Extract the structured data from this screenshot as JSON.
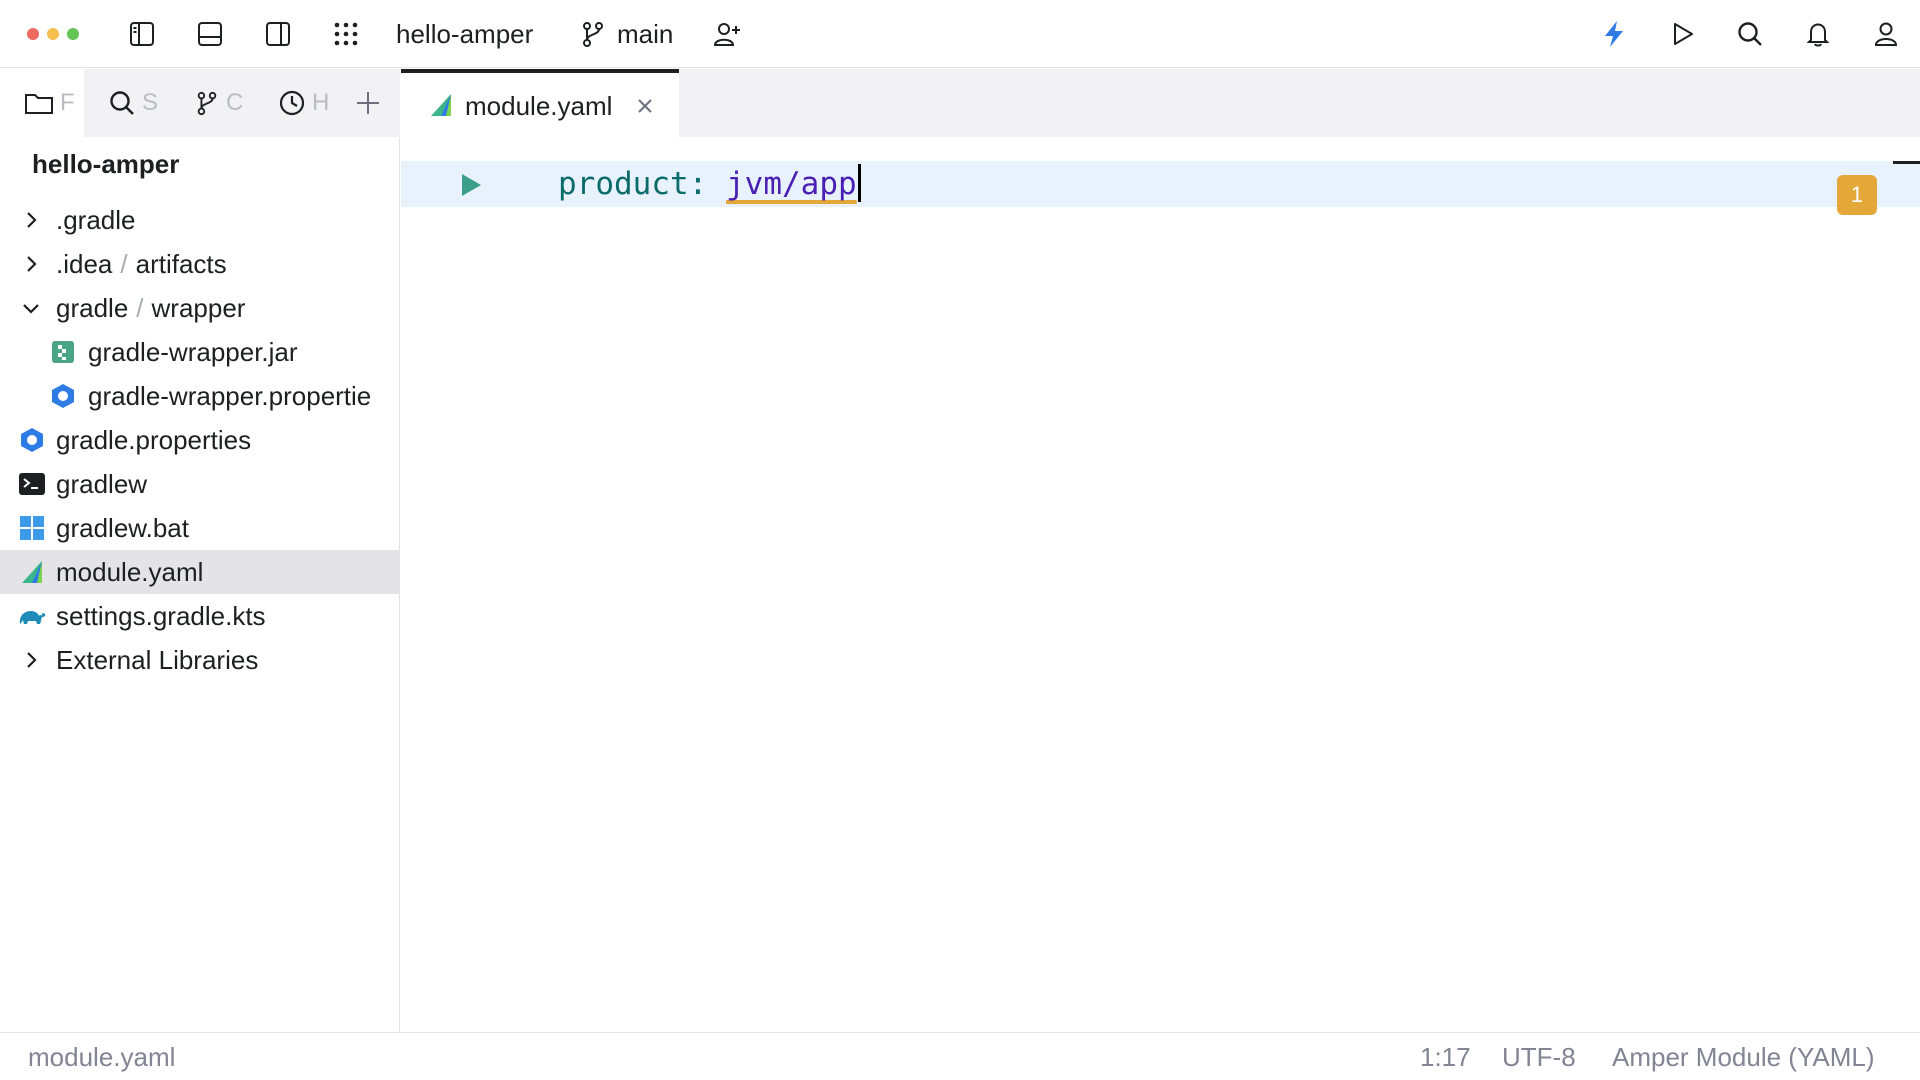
{
  "toolbar": {
    "project_name": "hello-amper",
    "branch": "main",
    "icons": [
      "left-panel-icon",
      "bottom-panel-icon",
      "right-panel-icon",
      "apps-grid-icon",
      "git-branch-icon",
      "add-user-icon",
      "lightning-icon",
      "run-icon",
      "search-icon",
      "bell-icon",
      "profile-icon"
    ],
    "colors": {
      "close": "#ed6a5e",
      "minimize": "#f5bf4f",
      "maximize": "#62c554",
      "accent": "#2f7be6"
    }
  },
  "sidebar": {
    "tabs": [
      {
        "label": "F",
        "icon": "folder-icon"
      },
      {
        "label": "S",
        "icon": "search-icon"
      },
      {
        "label": "C",
        "icon": "git-branch-icon"
      },
      {
        "label": "H",
        "icon": "clock-icon"
      }
    ],
    "project_title": "hello-amper",
    "tree": [
      {
        "label": ".gradle",
        "expand": "collapsed"
      },
      {
        "label": ".idea",
        "label2": "artifacts",
        "expand": "collapsed"
      },
      {
        "label": "gradle",
        "label2": "wrapper",
        "expand": "expanded"
      },
      {
        "label": "gradle-wrapper.jar",
        "icon": "jar-icon"
      },
      {
        "label": "gradle-wrapper.propertie",
        "icon": "properties-icon"
      },
      {
        "label": "gradle.properties",
        "icon": "properties-icon"
      },
      {
        "label": "gradlew",
        "icon": "terminal-icon"
      },
      {
        "label": "gradlew.bat",
        "icon": "windows-icon"
      },
      {
        "label": "module.yaml",
        "icon": "amper-icon",
        "selected": true
      },
      {
        "label": "settings.gradle.kts",
        "icon": "gradle-elephant-icon"
      },
      {
        "label": "External Libraries",
        "expand": "collapsed"
      }
    ]
  },
  "editor": {
    "tab_label": "module.yaml",
    "code": {
      "key": "product",
      "colon": ":",
      "value": "jvm/app"
    },
    "warning_count": "1"
  },
  "statusbar": {
    "file": "module.yaml",
    "position": "1:17",
    "encoding": "UTF-8",
    "file_type": "Amper Module (YAML)"
  }
}
